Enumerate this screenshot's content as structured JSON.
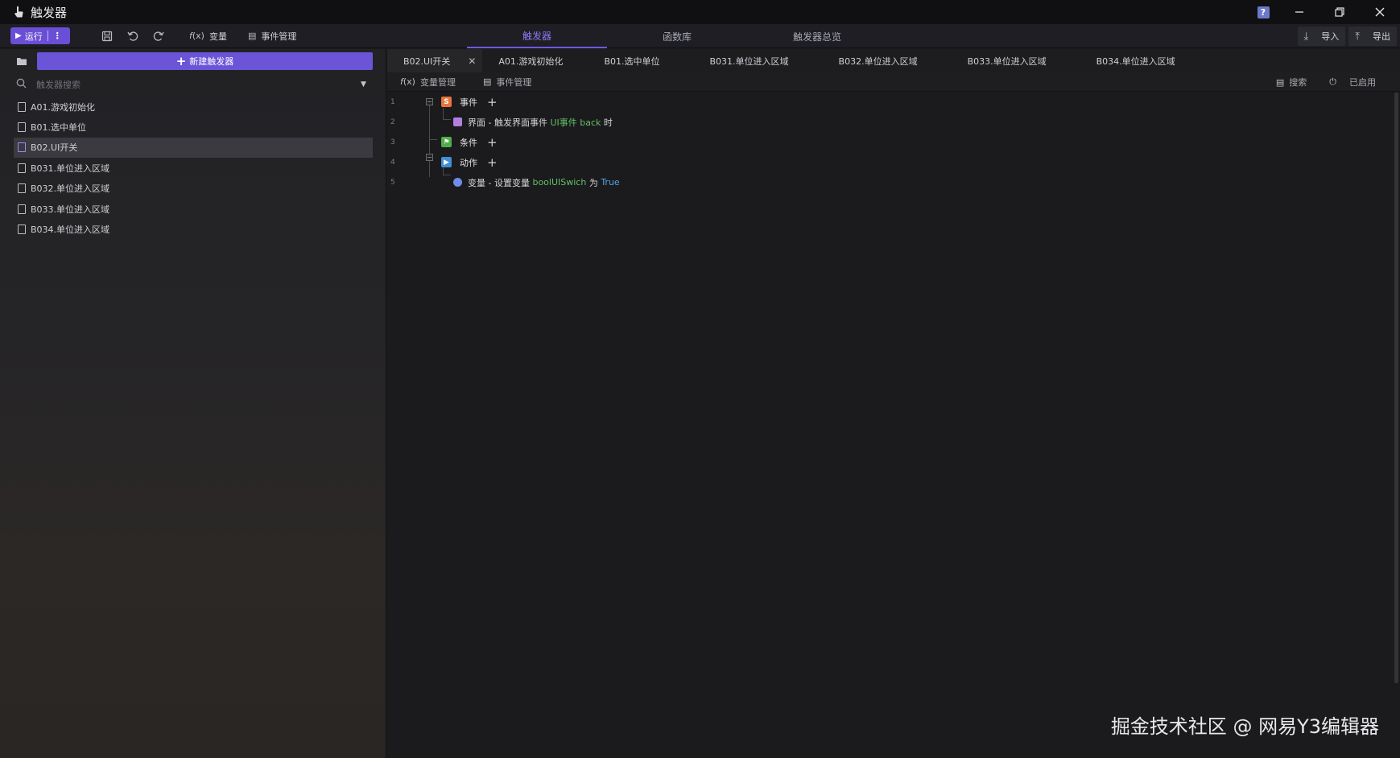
{
  "window": {
    "title": "触发器"
  },
  "toolbar": {
    "run_label": "运行",
    "more_label": "⋮",
    "variable_label": "变量",
    "event_mgmt_label": "事件管理",
    "main_tabs": [
      {
        "label": "触发器",
        "active": true
      },
      {
        "label": "函数库",
        "active": false
      },
      {
        "label": "触发器总览",
        "active": false
      }
    ],
    "import_label": "导入",
    "export_label": "导出"
  },
  "sidebar": {
    "new_trigger_label": "新建触发器",
    "search_placeholder": "触发器搜索",
    "items": [
      {
        "label": "A01.游戏初始化",
        "selected": false
      },
      {
        "label": "B01.选中单位",
        "selected": false
      },
      {
        "label": "B02.UI开关",
        "selected": true
      },
      {
        "label": "B031.单位进入区域",
        "selected": false
      },
      {
        "label": "B032.单位进入区域",
        "selected": false
      },
      {
        "label": "B033.单位进入区域",
        "selected": false
      },
      {
        "label": "B034.单位进入区域",
        "selected": false
      }
    ]
  },
  "editor": {
    "tabs": [
      {
        "label": "B02.UI开关",
        "active": true,
        "close": "✕"
      },
      {
        "label": "A01.游戏初始化",
        "active": false
      },
      {
        "label": "B01.选中单位",
        "active": false
      },
      {
        "label": "B031.单位进入区域",
        "active": false
      },
      {
        "label": "B032.单位进入区域",
        "active": false
      },
      {
        "label": "B033.单位进入区域",
        "active": false
      },
      {
        "label": "B034.单位进入区域",
        "active": false
      }
    ],
    "subbar": {
      "var_mgmt_label": "变量管理",
      "event_mgmt_label": "事件管理",
      "search_label": "搜索",
      "enabled_label": "已启用"
    },
    "lines": {
      "n1": "1",
      "n2": "2",
      "n3": "3",
      "n4": "4",
      "n5": "5",
      "event_label": "事件",
      "event_stmt_prefix": "界面 - 触发界面事件 ",
      "event_stmt_value": "UI事件 back",
      "event_stmt_suffix": " 时",
      "condition_label": "条件",
      "action_label": "动作",
      "action_stmt_prefix": "变量 - 设置变量 ",
      "action_stmt_var": "boolUISwich",
      "action_stmt_mid": " 为 ",
      "action_stmt_value": "True"
    }
  },
  "watermark": "掘金技术社区 @ 网易Y3编辑器",
  "colors": {
    "accent": "#6b54d8",
    "event_badge": "#e8743b",
    "condition_badge": "#4fae4a",
    "action_badge": "#3f8fd6"
  }
}
